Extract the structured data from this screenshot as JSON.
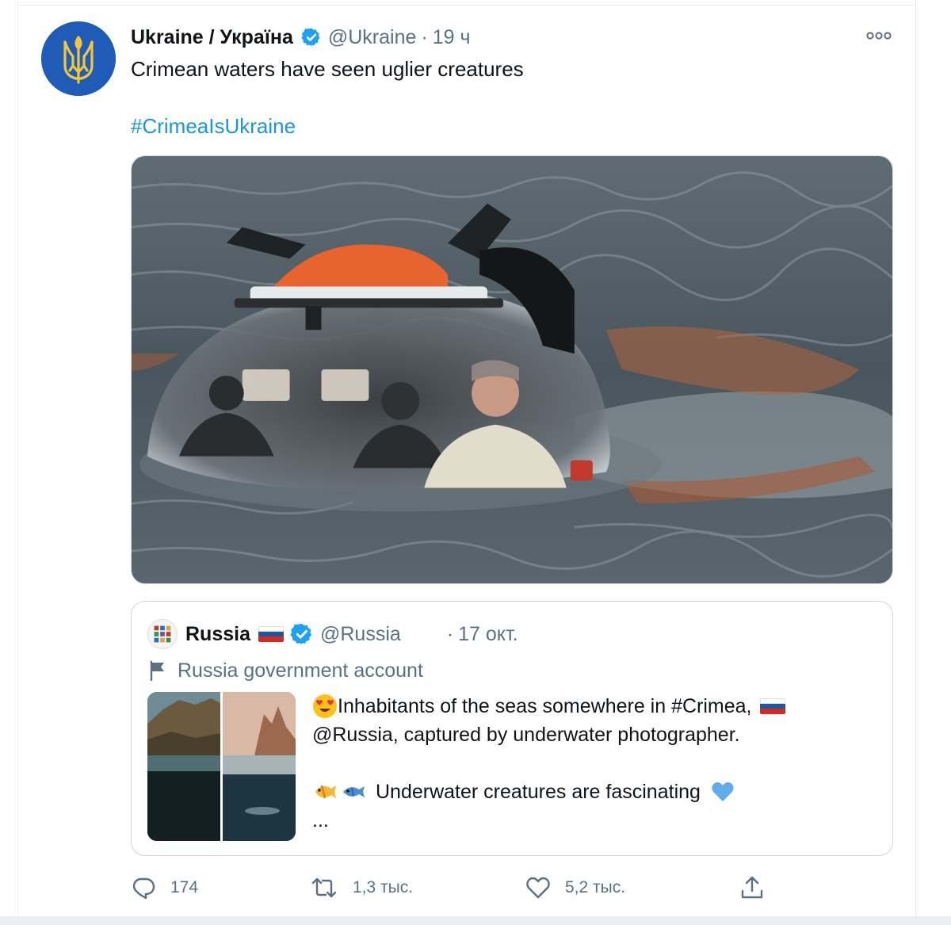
{
  "tweet": {
    "author_name": "Ukraine / Україна",
    "handle": "@Ukraine",
    "separator": "·",
    "time": "19 ч",
    "text": "Crimean waters have seen uglier creatures",
    "hashtag": "#CrimeaIsUkraine",
    "icons": {
      "avatar": "ukraine-trident-icon",
      "verified": "verified-badge-icon",
      "more": "more-options-icon"
    }
  },
  "quoted_tweet": {
    "author_name": "Russia",
    "handle": "@Russia",
    "separator": "·",
    "time": "17 окт.",
    "account_label": "Russia government account",
    "line1": "Inhabitants of the seas somewhere in #Crimea,",
    "line2": "@Russia, captured by underwater photographer.",
    "line3": "Underwater creatures are fascinating",
    "ellipsis": "...",
    "icons": {
      "flag": "russia-flag-icon",
      "gov": "flag-outline-icon",
      "emoji1": "heart-eyes-emoji",
      "emoji2": "tropical-fish-emoji",
      "emoji3": "fish-emoji",
      "emoji4": "blue-heart-emoji"
    }
  },
  "actions": {
    "reply_count": "174",
    "retweet_count": "1,3 тыс.",
    "like_count": "5,2 тыс.",
    "icons": [
      "reply-icon",
      "retweet-icon",
      "like-icon",
      "share-icon"
    ]
  },
  "colors": {
    "link": "#1b95e0",
    "muted": "#5b7083",
    "verified": "#1da1f2",
    "border": "#ccd6dd"
  }
}
